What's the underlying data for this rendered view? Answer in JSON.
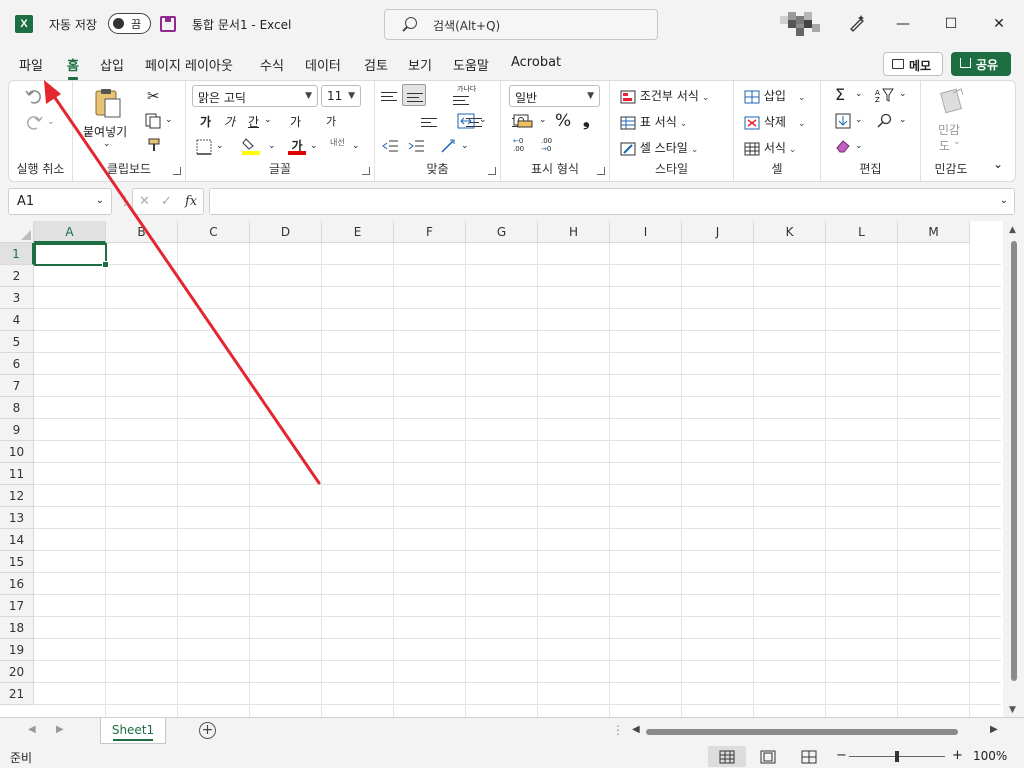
{
  "titlebar": {
    "app_badge": "X",
    "autosave_label": "자동 저장",
    "autosave_state": "끔",
    "doc_title": "통합 문서1  -  Excel",
    "search_placeholder": "검색(Alt+Q)",
    "minimize": "—",
    "maximize": "☐",
    "close": "✕"
  },
  "tabs": [
    "파일",
    "홈",
    "삽입",
    "페이지 레이아웃",
    "수식",
    "데이터",
    "검토",
    "보기",
    "도움말",
    "Acrobat"
  ],
  "active_tab": "홈",
  "memo_label": "메모",
  "share_label": "공유",
  "ribbon": {
    "undo_group_label": "실행 취소",
    "clipboard": {
      "paste_label": "붙여넣기",
      "group_label": "클립보드"
    },
    "font": {
      "font_name": "맑은 고딕",
      "font_size": "11",
      "grow_label": "가",
      "shrink_label": "가",
      "bold_label": "가",
      "italic_label": "가",
      "underline_label": "간",
      "font_color_label": "가",
      "phonetic_label": "내선",
      "group_label": "글꼴"
    },
    "alignment": {
      "wrap_label": "가나다",
      "group_label": "맞춤"
    },
    "number": {
      "format": "일반",
      "percent": "%",
      "comma": "❟",
      "inc_decimal": ".00",
      "dec_decimal": ".00",
      "group_label": "표시 형식"
    },
    "styles": {
      "conditional": "조건부 서식",
      "as_table": "표 서식",
      "cell_styles": "셀 스타일",
      "group_label": "스타일"
    },
    "cells": {
      "insert": "삽입",
      "delete": "삭제",
      "format": "서식",
      "group_label": "셀"
    },
    "editing": {
      "group_label": "편집"
    },
    "sensitivity": {
      "line1": "민감",
      "line2": "도",
      "group_label": "민감도"
    }
  },
  "formula_bar": {
    "name_box": "A1",
    "fx": "fx",
    "cancel": "✕",
    "enter": "✓",
    "formula": ""
  },
  "grid": {
    "columns": [
      "A",
      "B",
      "C",
      "D",
      "E",
      "F",
      "G",
      "H",
      "I",
      "J",
      "K",
      "L",
      "M"
    ],
    "rows": [
      "1",
      "2",
      "3",
      "4",
      "5",
      "6",
      "7",
      "8",
      "9",
      "10",
      "11",
      "12",
      "13",
      "14",
      "15",
      "16",
      "17",
      "18",
      "19",
      "20",
      "21"
    ],
    "selected_cell": "A1"
  },
  "sheets": [
    "Sheet1"
  ],
  "add_sheet_label": "+",
  "status": {
    "ready_label": "준비",
    "zoom_minus": "−",
    "zoom_plus": "+",
    "zoom": "100%"
  },
  "colors": {
    "accent": "#1d6f42",
    "annotation_arrow": "#e3262f",
    "font_color_bar": "#e00000",
    "highlight_bar": "#ffff00"
  }
}
